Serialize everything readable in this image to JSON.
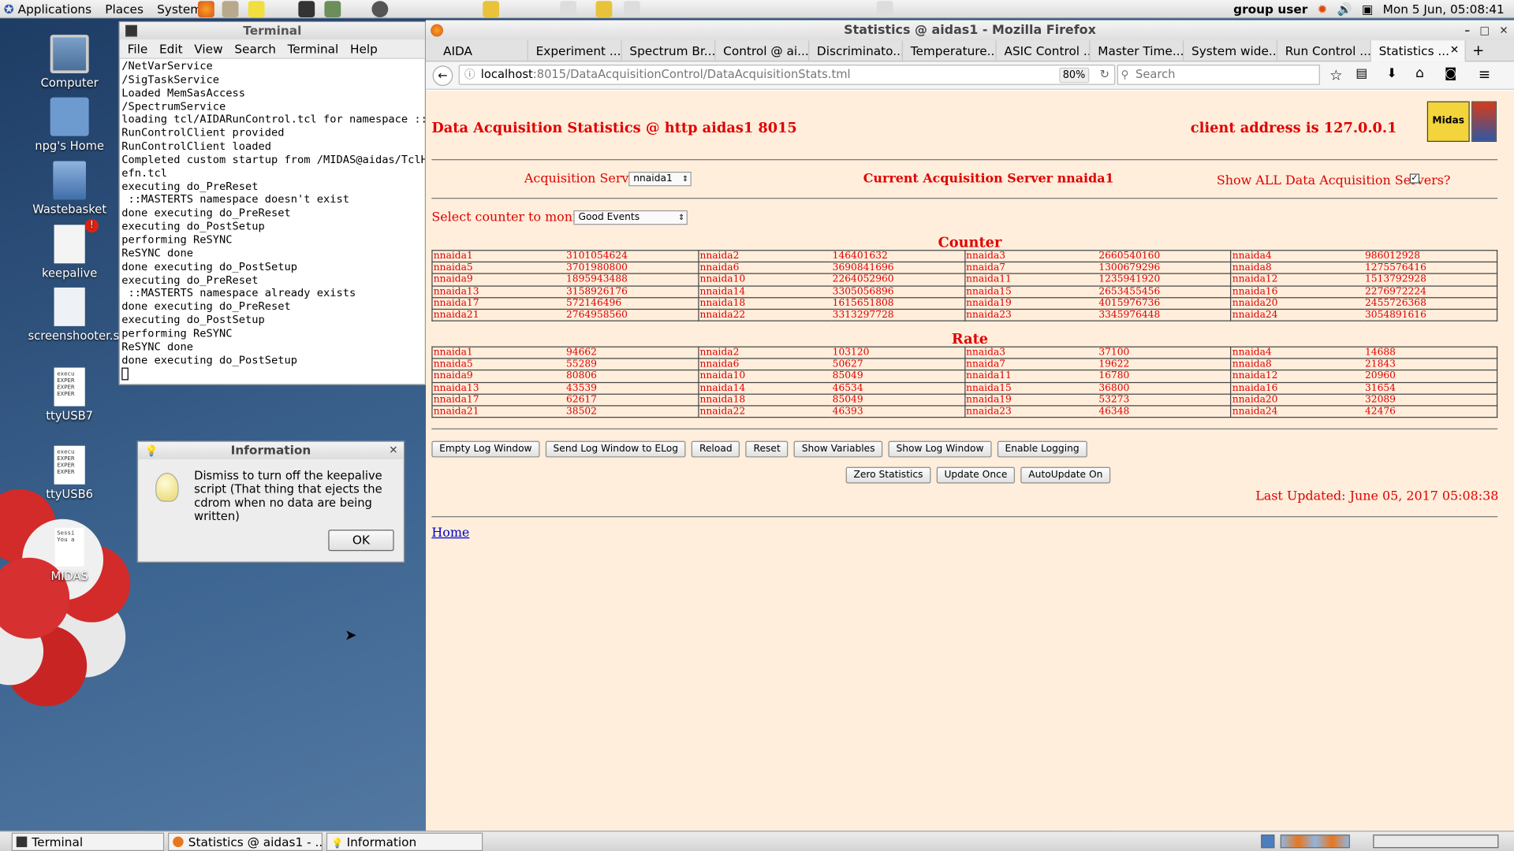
{
  "topbar": {
    "menus": [
      "Applications",
      "Places",
      "System"
    ],
    "user": "group user",
    "clock": "Mon 5 Jun, 05:08:41"
  },
  "desktop": {
    "icons": [
      "Computer",
      "npg's Home",
      "Wastebasket",
      "keepalive",
      "screenshooter.sh",
      "ttyUSB7",
      "ttyUSB6",
      "MIDAS"
    ],
    "script_preview": "execu\nEXPER\nEXPER\nEXPER",
    "midas_preview": "Sessi\nYou a"
  },
  "terminal": {
    "title": "Terminal",
    "menu": [
      "File",
      "Edit",
      "View",
      "Search",
      "Terminal",
      "Help"
    ],
    "output": "/NetVarService\n/SigTaskService\nLoaded MemSasAccess\n/SpectrumService\nloading tcl/AIDARunControl.tcl for namespace ::\nRunControlClient provided\nRunControlClient loaded\nCompleted custom startup from /MIDAS@aidas/TclHt\nefn.tcl\nexecuting do_PreReset\n ::MASTERTS namespace doesn't exist\ndone executing do_PreReset\nexecuting do_PostSetup\nperforming ReSYNC\nReSYNC done\ndone executing do_PostSetup\nexecuting do_PreReset\n ::MASTERTS namespace already exists\ndone executing do_PreReset\nexecuting do_PostSetup\nperforming ReSYNC\nReSYNC done\ndone executing do_PostSetup\n"
  },
  "browser": {
    "window_title": "Statistics @ aidas1 - Mozilla Firefox",
    "tabs": [
      "AIDA",
      "Experiment ...",
      "Spectrum Br...",
      "Control @ ai...",
      "Discriminato...",
      "Temperature...",
      "ASIC Control ...",
      "Master Time...",
      "System wide...",
      "Run Control ...",
      "Statistics ..."
    ],
    "url_host": "localhost",
    "url_rest": ":8015/DataAcquisitionControl/DataAcquisitionStats.tml",
    "zoom": "80%",
    "search_placeholder": "Search"
  },
  "page": {
    "title": "Data Acquisition Statistics @ http aidas1 8015",
    "client": "client address is 127.0.0.1",
    "acq_label": "Acquisition Servers",
    "acq_value": "nnaida1",
    "current_server": "Current Acquisition Server nnaida1",
    "show_all": "Show ALL Data Acquisition Servers?",
    "counter_label": "Select counter to monitor",
    "counter_value": "Good Events",
    "counter_title": "Counter",
    "rate_title": "Rate",
    "counter": [
      [
        "nnaida1",
        "3101054624",
        "nnaida2",
        "146401632",
        "nnaida3",
        "2660540160",
        "nnaida4",
        "986012928"
      ],
      [
        "nnaida5",
        "3701980800",
        "nnaida6",
        "3690841696",
        "nnaida7",
        "1300679296",
        "nnaida8",
        "1275576416"
      ],
      [
        "nnaida9",
        "1895943488",
        "nnaida10",
        "2264052960",
        "nnaida11",
        "1235941920",
        "nnaida12",
        "1513792928"
      ],
      [
        "nnaida13",
        "3158926176",
        "nnaida14",
        "3305056896",
        "nnaida15",
        "2653455456",
        "nnaida16",
        "2276972224"
      ],
      [
        "nnaida17",
        "572146496",
        "nnaida18",
        "1615651808",
        "nnaida19",
        "4015976736",
        "nnaida20",
        "2455726368"
      ],
      [
        "nnaida21",
        "2764958560",
        "nnaida22",
        "3313297728",
        "nnaida23",
        "3345976448",
        "nnaida24",
        "3054891616"
      ]
    ],
    "rate": [
      [
        "nnaida1",
        "94662",
        "nnaida2",
        "103120",
        "nnaida3",
        "37100",
        "nnaida4",
        "14688"
      ],
      [
        "nnaida5",
        "55289",
        "nnaida6",
        "50627",
        "nnaida7",
        "19622",
        "nnaida8",
        "21843"
      ],
      [
        "nnaida9",
        "80806",
        "nnaida10",
        "85049",
        "nnaida11",
        "16780",
        "nnaida12",
        "20960"
      ],
      [
        "nnaida13",
        "43539",
        "nnaida14",
        "46534",
        "nnaida15",
        "36800",
        "nnaida16",
        "31654"
      ],
      [
        "nnaida17",
        "62617",
        "nnaida18",
        "85049",
        "nnaida19",
        "53273",
        "nnaida20",
        "32089"
      ],
      [
        "nnaida21",
        "38502",
        "nnaida22",
        "46393",
        "nnaida23",
        "46348",
        "nnaida24",
        "42476"
      ]
    ],
    "buttons1": [
      "Empty Log Window",
      "Send Log Window to ELog",
      "Reload",
      "Reset",
      "Show Variables",
      "Show Log Window",
      "Enable Logging"
    ],
    "buttons2": [
      "Zero Statistics",
      "Update Once",
      "AutoUpdate On"
    ],
    "last_updated": "Last Updated: June 05, 2017 05:08:38",
    "home": "Home",
    "logo_text": "Midas"
  },
  "dialog": {
    "title": "Information",
    "message": "Dismiss to turn off the keepalive script (That thing that ejects the cdrom when no data are being written)",
    "ok": "OK"
  },
  "taskbar": [
    "Terminal",
    "Statistics @ aidas1 - ...",
    "Information"
  ]
}
